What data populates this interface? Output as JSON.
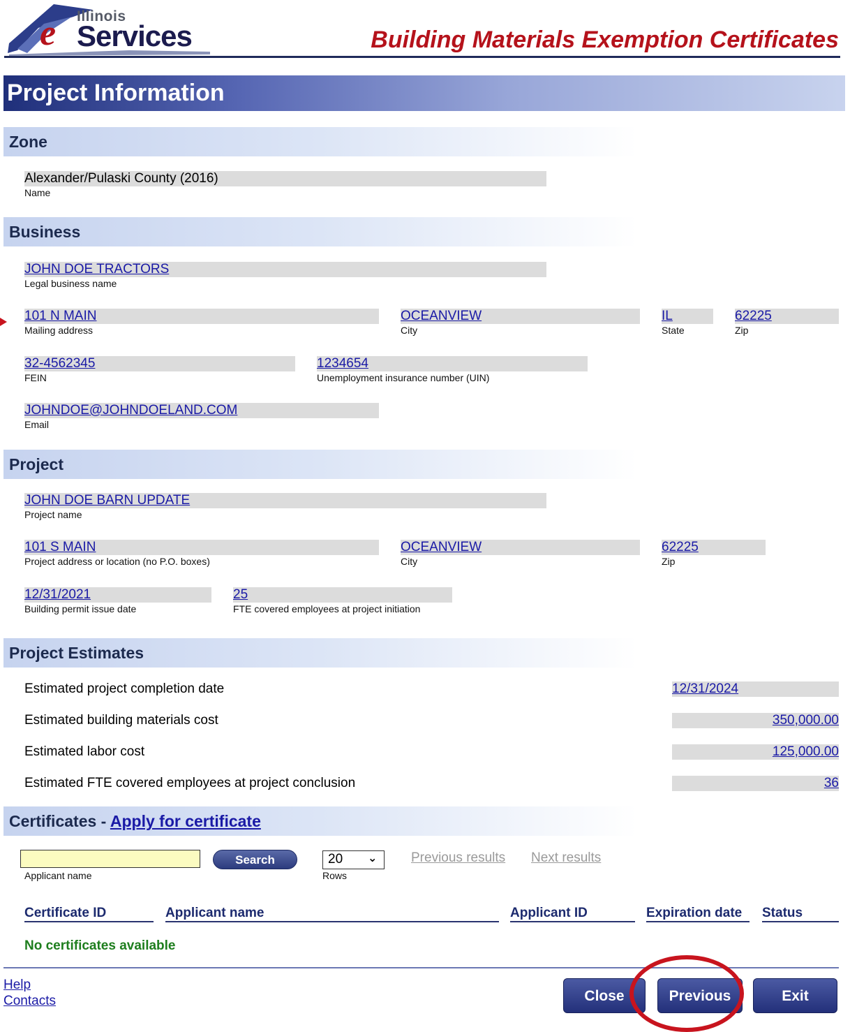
{
  "header": {
    "logo": {
      "line1": "Illinois",
      "e": "e",
      "line2": "Services"
    },
    "app_title": "Building Materials Exemption Certificates"
  },
  "page_title": "Project Information",
  "zone": {
    "section_title": "Zone",
    "name_value": "Alexander/Pulaski County (2016)",
    "name_label": "Name"
  },
  "business": {
    "section_title": "Business",
    "legal_name": "JOHN DOE TRACTORS",
    "legal_name_label": "Legal business name",
    "mailing_address": "101 N MAIN",
    "mailing_address_label": "Mailing address",
    "city": "OCEANVIEW",
    "city_label": "City",
    "state": "IL",
    "state_label": "State",
    "zip": "62225",
    "zip_label": "Zip",
    "fein": "32-4562345",
    "fein_label": "FEIN",
    "uin": "1234654",
    "uin_label": "Unemployment insurance number (UIN)",
    "email": "JOHNDOE@JOHNDOELAND.COM",
    "email_label": "Email"
  },
  "project": {
    "section_title": "Project",
    "name": "JOHN DOE BARN UPDATE",
    "name_label": "Project name",
    "address": "101 S MAIN",
    "address_label": "Project address or location (no P.O. boxes)",
    "city": "OCEANVIEW",
    "city_label": "City",
    "zip": "62225",
    "zip_label": "Zip",
    "permit_date": "12/31/2021",
    "permit_date_label": "Building permit issue date",
    "fte_initiation": "25",
    "fte_initiation_label": "FTE covered employees at project initiation"
  },
  "estimates": {
    "section_title": "Project Estimates",
    "rows": [
      {
        "label": "Estimated project completion date",
        "value": "12/31/2024"
      },
      {
        "label": "Estimated building materials cost",
        "value": "350,000.00"
      },
      {
        "label": "Estimated labor cost",
        "value": "125,000.00"
      },
      {
        "label": "Estimated FTE covered employees at project conclusion",
        "value": "36"
      }
    ]
  },
  "certificates": {
    "section_title": "Certificates - ",
    "apply_link": "Apply for certificate",
    "search_input_value": "",
    "search_input_label": "Applicant name",
    "search_button": "Search",
    "rows_value": "20",
    "rows_label": "Rows",
    "previous_results": "Previous results",
    "next_results": "Next results",
    "columns": [
      "Certificate ID",
      "Applicant name",
      "Applicant ID",
      "Expiration date",
      "Status"
    ],
    "empty_message": "No certificates available"
  },
  "footer": {
    "help": "Help",
    "contacts": "Contacts",
    "close_button": "Close",
    "previous_button": "Previous",
    "exit_button": "Exit"
  },
  "colors": {
    "brand_red": "#b5121b",
    "navy": "#1f2a5a",
    "link_blue": "#1a1aa6",
    "field_grey": "#dcdcdc",
    "success_green": "#1e7e1e",
    "annotation_red": "#c8141e"
  }
}
